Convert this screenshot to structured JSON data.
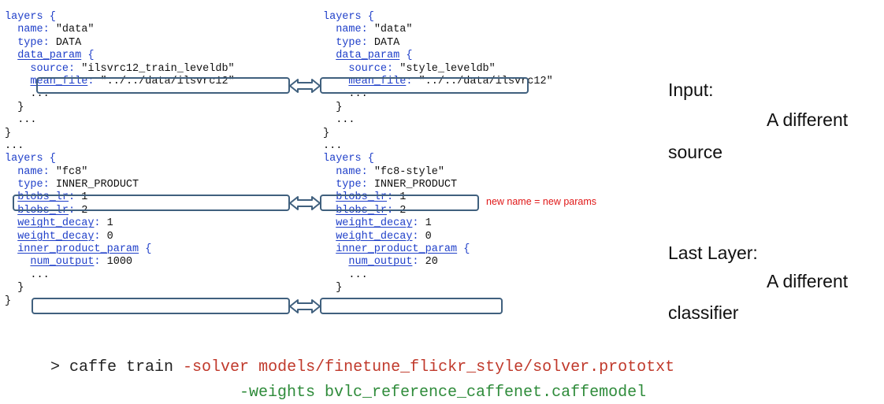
{
  "left": {
    "lines": [
      "layers {",
      "  name: \"data\"",
      "  type: DATA",
      "  data_param {",
      "    source: \"ilsvrc12_train_leveldb\"",
      "    mean_file: \"../../data/ilsvrc12\"",
      "    ...",
      "  }",
      "  ...",
      "}",
      "...",
      "layers {",
      "  name: \"fc8\"",
      "  type: INNER_PRODUCT",
      "  blobs_lr: 1",
      "  blobs_lr: 2",
      "  weight_decay: 1",
      "  weight_decay: 0",
      "  inner_product_param {",
      "    num_output: 1000",
      "    ...",
      "  }",
      "}"
    ]
  },
  "right": {
    "lines": [
      "layers {",
      "  name: \"data\"",
      "  type: DATA",
      "  data_param {",
      "    source: \"style_leveldb\"",
      "    mean_file: \"../../data/ilsvrc12\"",
      "    ...",
      "  }",
      "  ...",
      "}",
      "...",
      "layers {",
      "  name: \"fc8-style\"",
      "  type: INNER_PRODUCT",
      "  blobs_lr: 1",
      "  blobs_lr: 2",
      "  weight_decay: 1",
      "  weight_decay: 0",
      "  inner_product_param {",
      "    num_output: 20",
      "    ...",
      "  }"
    ]
  },
  "annotations": {
    "input_label": "Input:",
    "input_desc_1": "A different",
    "input_desc_2": "source",
    "last_layer_label": "Last Layer:",
    "last_layer_desc_1": "A different",
    "last_layer_desc_2": "classifier",
    "new_name_note": "new name = new params"
  },
  "command": {
    "prompt": "> caffe train",
    "line1_args": "-solver models/finetune_flickr_style/solver.prototxt",
    "line2_args": "-weights bvlc_reference_caffenet.caffemodel"
  },
  "colors": {
    "keyword": "#1f3fc9",
    "highlight_box": "#40607e",
    "note": "#e01818",
    "solver_arg": "#c0392b",
    "weights_arg": "#2e8b3a"
  }
}
